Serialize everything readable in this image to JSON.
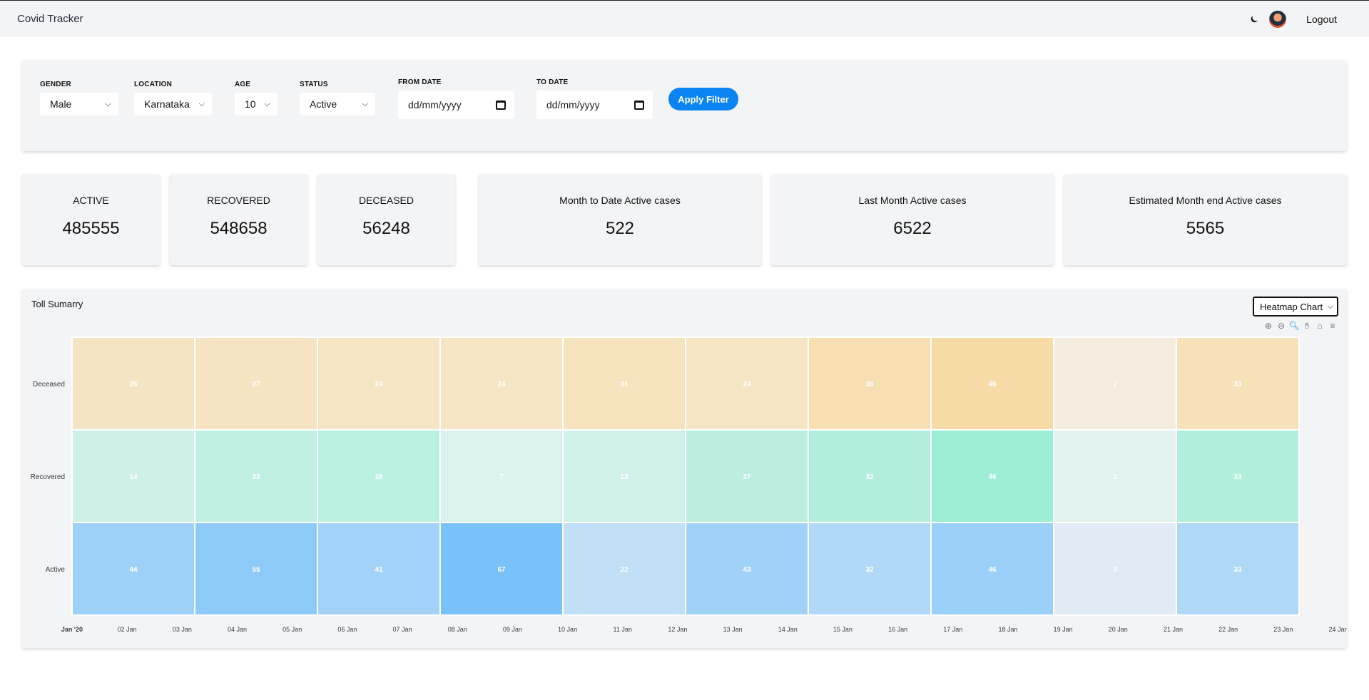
{
  "app": {
    "title": "Covid Tracker",
    "logout_label": "Logout"
  },
  "filters": {
    "gender": {
      "label": "GENDER",
      "value": "Male"
    },
    "location": {
      "label": "LOCATION",
      "value": "Karnataka"
    },
    "age": {
      "label": "AGE",
      "value": "10"
    },
    "status": {
      "label": "STATUS",
      "value": "Active"
    },
    "from_date": {
      "label": "FROM DATE",
      "placeholder": "dd/mm/yyyy"
    },
    "to_date": {
      "label": "TO DATE",
      "placeholder": "dd/mm/yyyy"
    },
    "apply_label": "Apply Filter"
  },
  "stats": [
    {
      "label": "ACTIVE",
      "value": "485555"
    },
    {
      "label": "RECOVERED",
      "value": "548658"
    },
    {
      "label": "DECEASED",
      "value": "56248"
    },
    {
      "label": "Month to Date Active cases",
      "value": "522"
    },
    {
      "label": "Last Month Active cases",
      "value": "6522"
    },
    {
      "label": "Estimated Month end Active cases",
      "value": "5565"
    }
  ],
  "chart": {
    "title": "Toll Sumarry",
    "type_select": "Heatmap Chart",
    "toolbar_icons": [
      "zoom-in-icon",
      "zoom-out-icon",
      "selection-zoom-icon",
      "pan-hand-icon",
      "reset-home-icon",
      "menu-icon"
    ]
  },
  "chart_data": {
    "type": "heatmap",
    "series": [
      {
        "name": "Deceased",
        "values": [
          26,
          27,
          24,
          24,
          31,
          24,
          38,
          46,
          7,
          33
        ]
      },
      {
        "name": "Recovered",
        "values": [
          14,
          23,
          26,
          7,
          13,
          27,
          32,
          46,
          1,
          33
        ]
      },
      {
        "name": "Active",
        "values": [
          44,
          55,
          41,
          67,
          22,
          43,
          32,
          46,
          3,
          33
        ]
      }
    ],
    "x_tick_labels": [
      "Jan '20",
      "02 Jan",
      "03 Jan",
      "04 Jan",
      "05 Jan",
      "06 Jan",
      "07 Jan",
      "08 Jan",
      "09 Jan",
      "10 Jan",
      "11 Jan",
      "12 Jan",
      "13 Jan",
      "14 Jan",
      "15 Jan",
      "16 Jan",
      "17 Jan",
      "18 Jan",
      "19 Jan",
      "20 Jan",
      "21 Jan",
      "22 Jan",
      "23 Jan",
      "24 Jan"
    ],
    "colors": {
      "Deceased": "#feb019",
      "Recovered": "#00e396",
      "Active": "#008ffb"
    },
    "grid": false,
    "legend": "none"
  }
}
